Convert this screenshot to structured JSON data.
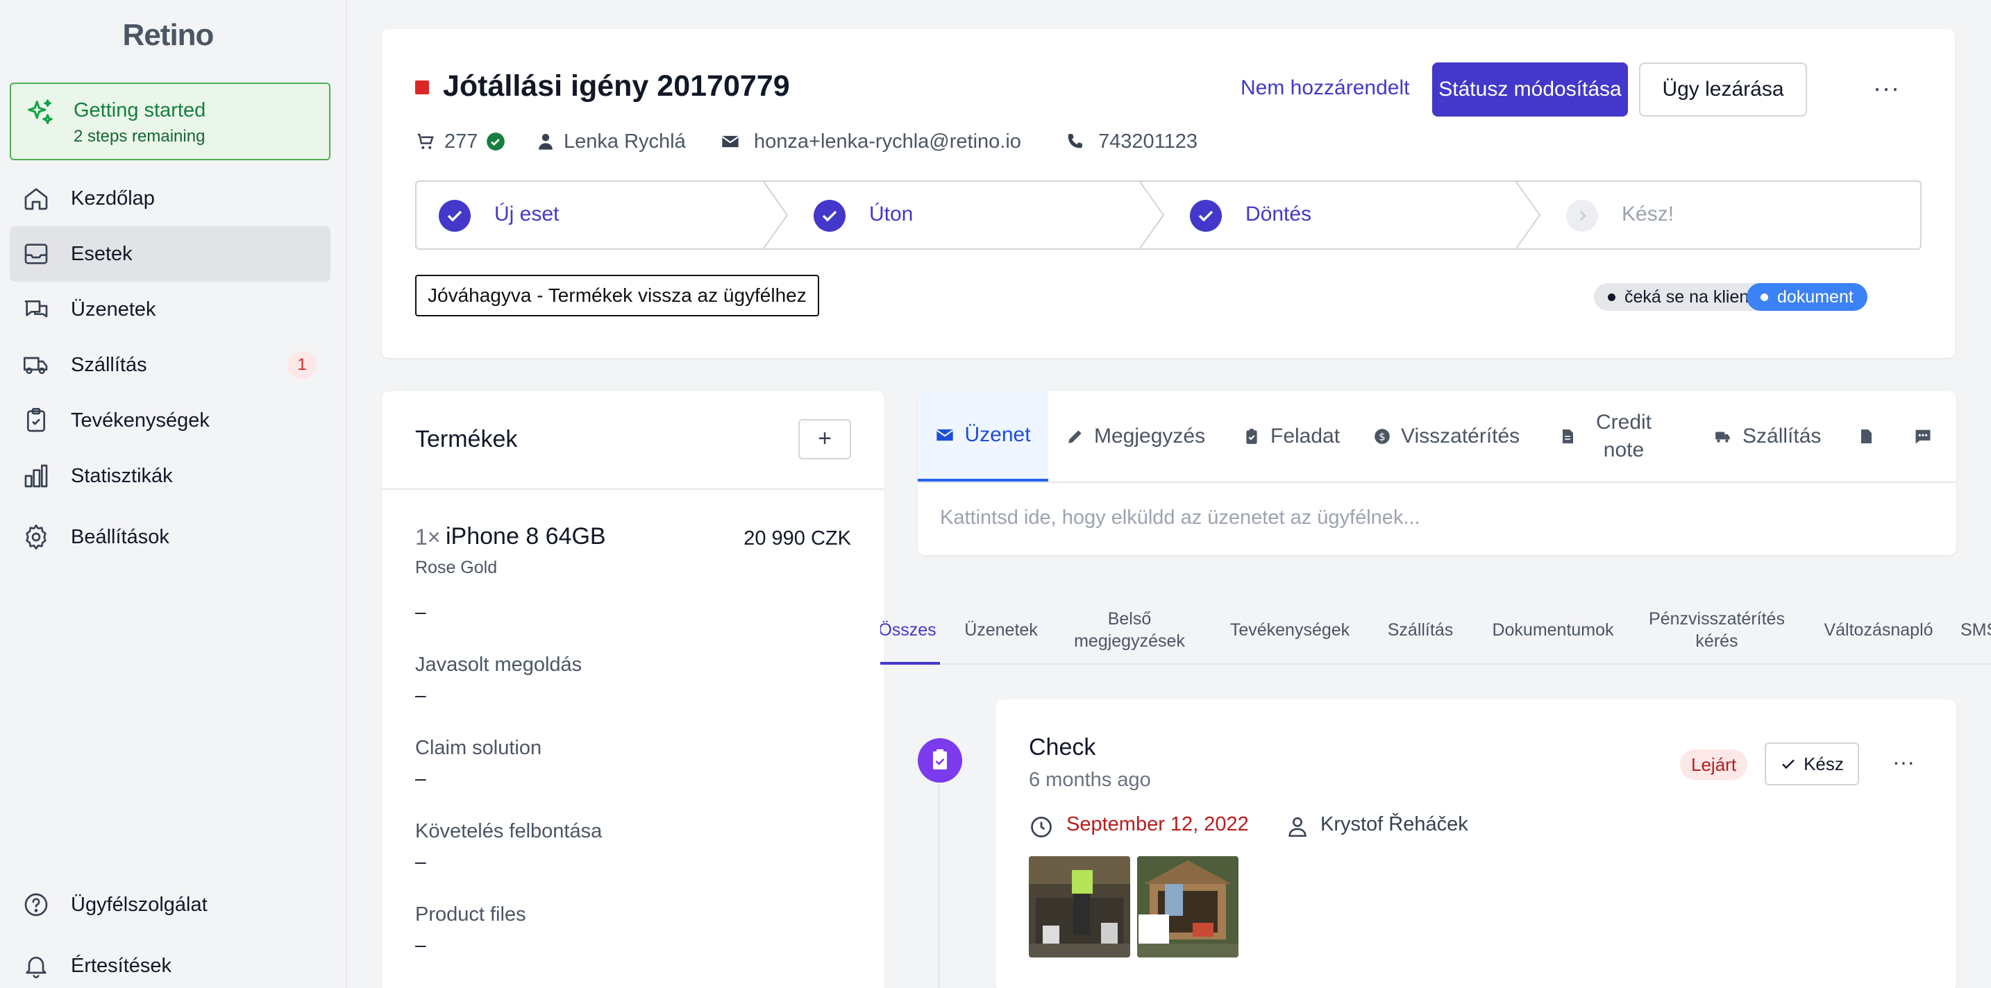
{
  "sidebar": {
    "logo": "Retino",
    "getting_started": {
      "title": "Getting started",
      "subtitle": "2 steps remaining"
    },
    "nav": [
      {
        "label": "Kezdőlap",
        "icon": "home-icon"
      },
      {
        "label": "Esetek",
        "icon": "inbox-icon",
        "active": true
      },
      {
        "label": "Üzenetek",
        "icon": "chat-icon"
      },
      {
        "label": "Szállítás",
        "icon": "truck-icon",
        "badge": "1"
      },
      {
        "label": "Tevékenységek",
        "icon": "clipboard-icon"
      },
      {
        "label": "Statisztikák",
        "icon": "chart-icon"
      },
      {
        "label": "Beállítások",
        "icon": "gear-icon"
      }
    ],
    "bottom": [
      {
        "label": "Ügyfélszolgálat",
        "icon": "help-icon"
      },
      {
        "label": "Értesítések",
        "icon": "bell-icon"
      }
    ]
  },
  "case": {
    "title": "Jótállási igény 20170779",
    "assignee_link": "Nem hozzárendelt",
    "status_button": "Státusz módosítása",
    "close_button": "Ügy lezárása",
    "more": "···",
    "order_number": "277",
    "customer_name": "Lenka Rychlá",
    "email": "honza+lenka-rychla@retino.io",
    "phone": "743201123",
    "steps": [
      {
        "label": "Új eset",
        "done": true
      },
      {
        "label": "Úton",
        "done": true
      },
      {
        "label": "Döntés",
        "done": true
      },
      {
        "label": "Kész!",
        "done": false
      }
    ],
    "status_text": "Jóváhagyva - Termékek vissza az ügyfélhez",
    "tags": [
      "čeká se na klienta",
      "dokument"
    ],
    "colors": {
      "accent": "#4338ca",
      "red": "#dc2626",
      "green": "#15803d",
      "tag_blue": "#3b82f6"
    }
  },
  "products": {
    "title": "Termékek",
    "add": "+",
    "item": {
      "qty": "1×",
      "name": "iPhone 8 64GB",
      "price": "20 990 CZK",
      "variant": "Rose Gold"
    },
    "first_value": "–",
    "fields": [
      {
        "label": "Javasolt megoldás",
        "value": "–"
      },
      {
        "label": "Claim solution",
        "value": "–"
      },
      {
        "label": "Követelés felbontása",
        "value": "–"
      },
      {
        "label": "Product files",
        "value": "–"
      }
    ]
  },
  "composer": {
    "tabs": [
      "Üzenet",
      "Megjegyzés",
      "Feladat",
      "Visszatérítés",
      "Credit note",
      "Szállítás"
    ],
    "placeholder": "Kattintsd ide, hogy elküldd az üzenetet az ügyfélnek..."
  },
  "timeline_tabs": [
    "Összes",
    "Üzenetek",
    "Belső megjegyzések",
    "Tevékenységek",
    "Szállítás",
    "Dokumentumok",
    "Pénzvisszatérítés kérés",
    "Változásnapló",
    "SMS"
  ],
  "task": {
    "title": "Check",
    "ago": "6 months ago",
    "expired": "Lejárt",
    "done": "Kész",
    "more": "···",
    "due_date": "September 12, 2022",
    "assignee": "Krystof Řeháček"
  }
}
